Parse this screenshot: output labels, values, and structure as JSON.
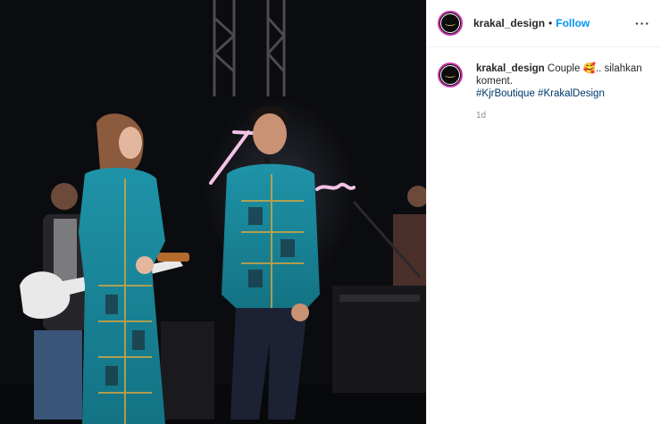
{
  "post": {
    "username": "krakal_design",
    "separator": "•",
    "follow_label": "Follow",
    "more_label": "···"
  },
  "comment": {
    "username": "krakal_design",
    "text_line1": "Couple 🥰.. silahkan",
    "text_line2": "koment.",
    "hashtags": "#KjrBoutique #KrakalDesign",
    "time": "1d"
  },
  "icons": {
    "avatar": "krakal-design-logo-icon",
    "more": "more-options-icon"
  },
  "colors": {
    "follow": "#0095f6",
    "hashtag": "#00376b",
    "avatar_ring": "#c837ab"
  }
}
